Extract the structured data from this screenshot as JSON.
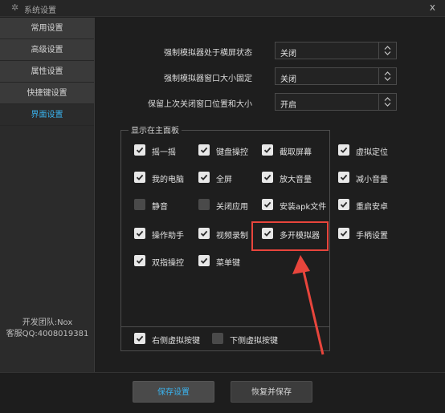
{
  "window": {
    "title": "系统设置",
    "close": "x"
  },
  "sidebar": {
    "items": [
      {
        "label": "常用设置"
      },
      {
        "label": "高级设置"
      },
      {
        "label": "属性设置"
      },
      {
        "label": "快捷键设置"
      },
      {
        "label": "界面设置"
      }
    ],
    "active_index": 4,
    "team": "开发团队:Nox",
    "qq": "客服QQ:4008019381"
  },
  "settings": {
    "rows": [
      {
        "label": "强制模拟器处于横屏状态",
        "value": "关闭"
      },
      {
        "label": "强制模拟器窗口大小固定",
        "value": "关闭"
      },
      {
        "label": "保留上次关闭窗口位置和大小",
        "value": "开启"
      }
    ]
  },
  "panel": {
    "title": "显示在主面板",
    "items": [
      {
        "label": "摇一摇",
        "checked": true
      },
      {
        "label": "键盘操控",
        "checked": true
      },
      {
        "label": "截取屏幕",
        "checked": true
      },
      {
        "label": "虚拟定位",
        "checked": true
      },
      {
        "label": "我的电脑",
        "checked": true
      },
      {
        "label": "全屏",
        "checked": true
      },
      {
        "label": "放大音量",
        "checked": true
      },
      {
        "label": "减小音量",
        "checked": true
      },
      {
        "label": "静音",
        "checked": false
      },
      {
        "label": "关闭应用",
        "checked": false
      },
      {
        "label": "安装apk文件",
        "checked": true
      },
      {
        "label": "重启安卓",
        "checked": true
      },
      {
        "label": "操作助手",
        "checked": true
      },
      {
        "label": "视频录制",
        "checked": true
      },
      {
        "label": "多开模拟器",
        "checked": true
      },
      {
        "label": "手柄设置",
        "checked": true
      },
      {
        "label": "双指操控",
        "checked": true
      },
      {
        "label": "菜单键",
        "checked": true
      }
    ],
    "virtual_keys": [
      {
        "label": "右侧虚拟按键",
        "checked": true
      },
      {
        "label": "下侧虚拟按键",
        "checked": false
      }
    ]
  },
  "buttons": {
    "save": "保存设置",
    "restore": "恢复并保存"
  },
  "colors": {
    "accent": "#3ab4f0",
    "highlight": "#e8453c"
  },
  "icons": {
    "title": "gear-icon",
    "checkbox": "check-icon",
    "select": "updown-chevron-icon"
  }
}
